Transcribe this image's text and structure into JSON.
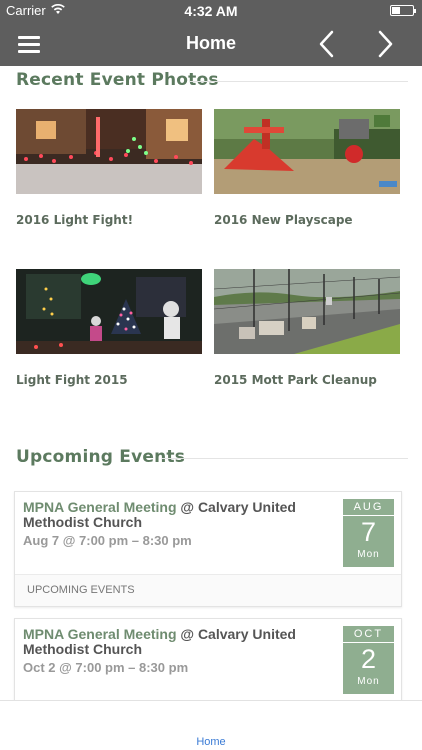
{
  "status_bar": {
    "carrier": "Carrier",
    "time": "4:32 AM"
  },
  "nav": {
    "title": "Home"
  },
  "recent_photos": {
    "heading": "Recent Event Photos",
    "items": [
      {
        "caption": "2016 Light Fight!"
      },
      {
        "caption": "2016 New Playscape"
      },
      {
        "caption": "Light Fight 2015"
      },
      {
        "caption": "2015 Mott Park Cleanup"
      }
    ]
  },
  "upcoming": {
    "heading": "Upcoming Events",
    "events": [
      {
        "event_name": "MPNA General Meeting",
        "venue": " @ Calvary United Methodist Church",
        "time": "Aug 7 @ 7:00 pm – 8:30 pm",
        "month": "AUG",
        "day": "7",
        "dow": "Mon",
        "footer": "UPCOMING EVENTS"
      },
      {
        "event_name": "MPNA General Meeting",
        "venue": " @ Calvary United Methodist Church",
        "time": "Oct 2 @ 7:00 pm – 8:30 pm",
        "month": "OCT",
        "day": "2",
        "dow": "Mon"
      }
    ]
  },
  "tab_bar": {
    "home_label": "Home",
    "accent": "#3a7bd5"
  },
  "theme": {
    "nav_bg": "#5e5e5e",
    "green_heading": "#5c7a5f",
    "date_box": "#8fae90"
  }
}
